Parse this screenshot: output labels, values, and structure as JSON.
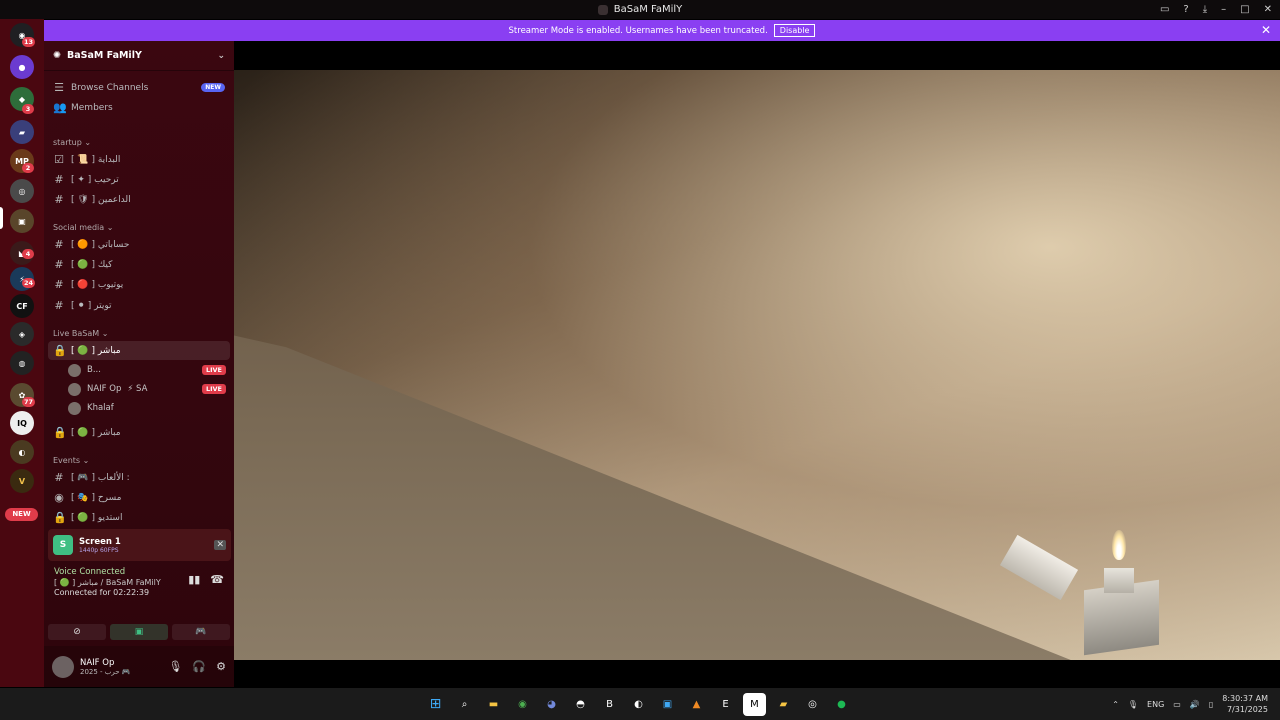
{
  "window": {
    "title": "BaSaM FaMilY"
  },
  "banner": {
    "text": "Streamer Mode is enabled. Usernames have been truncated.",
    "disable_label": "Disable",
    "color": "#8a3ff2"
  },
  "rail": {
    "badges": [
      {
        "label": "13"
      },
      {
        "label": "3"
      },
      {
        "label": "2"
      },
      {
        "label": "4"
      },
      {
        "label": "24"
      },
      {
        "label": "77"
      }
    ],
    "cf_label": "CF",
    "new_label": "NEW"
  },
  "server": {
    "name": "BaSaM FaMilY",
    "browse_label": "Browse Channels",
    "browse_tag": "NEW",
    "members_label": "Members"
  },
  "categories": [
    {
      "name": "startup"
    },
    {
      "name": "Social media"
    },
    {
      "name": "Live BaSaM"
    },
    {
      "name": "Events"
    }
  ],
  "channels": {
    "startup": [
      {
        "name": "[ 📜 ] البداية"
      },
      {
        "name": "[ ✦ ] ترحيب"
      },
      {
        "name": "[ 🛡 ] الداعمين"
      }
    ],
    "social": [
      {
        "name": "[ 🟠 ] حساباتي",
        "color": "#f26c2b"
      },
      {
        "name": "[ 🟢 ] كيك",
        "color": "#3fc46a"
      },
      {
        "name": "[ 🔴 ] يوتيوب",
        "color": "#e0313e"
      },
      {
        "name": "[ ⚫ ] تويتر",
        "color": "#222222"
      }
    ],
    "live": [
      {
        "name": "[ 🟢 ] مباشر",
        "color": "#3fc46a"
      },
      {
        "name": "[ 🟢 ] مباشر",
        "color": "#3fc46a"
      }
    ],
    "events": [
      {
        "name": "[ 🎮 ] الألعاب :"
      },
      {
        "name": "[ 🎭 ] مسرح"
      },
      {
        "name": "[ 🟢 ] استديو",
        "color": "#3fc46a"
      }
    ]
  },
  "voice_users": [
    {
      "name": "B...",
      "tag": "LIVE"
    },
    {
      "name": "NAIF Op",
      "extra": "⚡ SA",
      "tag": "LIVE"
    },
    {
      "name": "Khalaf"
    }
  ],
  "screen_share": {
    "title": "Screen 1",
    "quality": "1440p 60FPS",
    "icon_letter": "S"
  },
  "voice": {
    "status": "Voice Connected",
    "channel": "[ 🟢 ] مباشر / BaSaM FaMilY",
    "duration": "Connected for 02:22:39"
  },
  "user": {
    "name": "NAIF Op",
    "status": "2025 - حرب 🎮"
  },
  "taskbar": {
    "lang": "ENG",
    "time": "8:30:37 AM",
    "date": "7/31/2025"
  }
}
